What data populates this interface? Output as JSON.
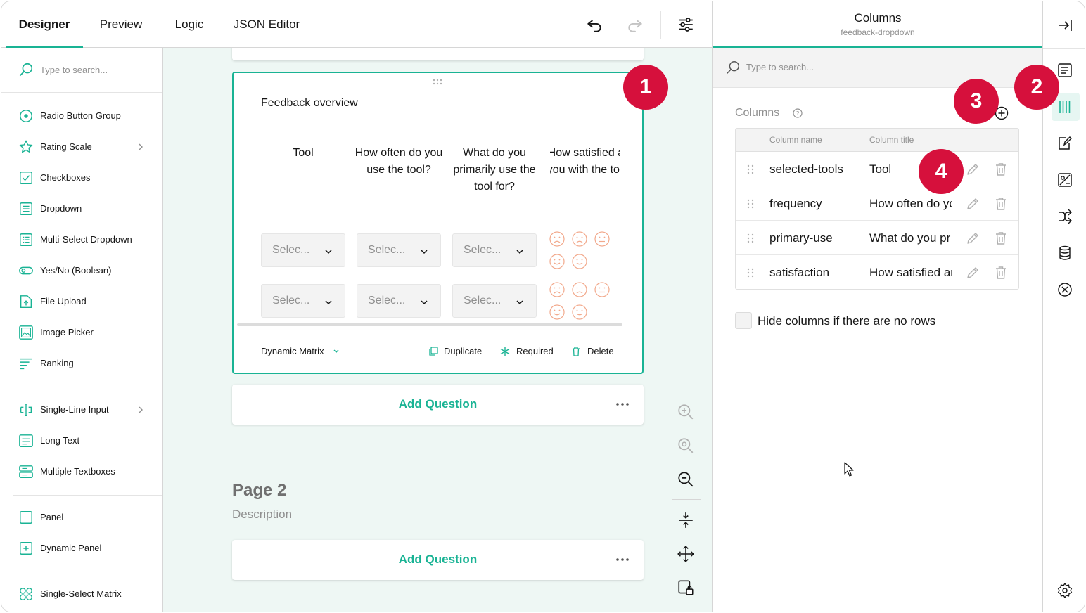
{
  "tabs": [
    "Designer",
    "Preview",
    "Logic",
    "JSON Editor"
  ],
  "toolbox": {
    "search_placeholder": "Type to search...",
    "items": [
      {
        "label": "Radio Button Group",
        "icon": "radio-icon"
      },
      {
        "label": "Rating Scale",
        "icon": "star-icon"
      },
      {
        "label": "Checkboxes",
        "icon": "checkbox-icon"
      },
      {
        "label": "Dropdown",
        "icon": "dropdown-icon"
      },
      {
        "label": "Multi-Select Dropdown",
        "icon": "multi-dropdown-icon"
      },
      {
        "label": "Yes/No (Boolean)",
        "icon": "toggle-icon"
      },
      {
        "label": "File Upload",
        "icon": "file-upload-icon"
      },
      {
        "label": "Image Picker",
        "icon": "image-picker-icon"
      },
      {
        "label": "Ranking",
        "icon": "ranking-icon"
      },
      {
        "label": "Single-Line Input",
        "icon": "text-input-icon"
      },
      {
        "label": "Long Text",
        "icon": "long-text-icon"
      },
      {
        "label": "Multiple Textboxes",
        "icon": "multiple-textboxes-icon"
      },
      {
        "label": "Panel",
        "icon": "panel-icon"
      },
      {
        "label": "Dynamic Panel",
        "icon": "dynamic-panel-icon"
      },
      {
        "label": "Single-Select Matrix",
        "icon": "matrix-icon"
      }
    ]
  },
  "question": {
    "title": "Feedback overview",
    "columns": [
      "Tool",
      "How often do you use the tool?",
      "What do you primarily use the tool for?",
      "How satisfied are you with the tool?"
    ],
    "select_placeholder": "Selec...",
    "type_label": "Dynamic Matrix",
    "duplicate_label": "Duplicate",
    "required_label": "Required",
    "delete_label": "Delete"
  },
  "add_question_label": "Add Question",
  "page2": {
    "title": "Page 2",
    "description": "Description"
  },
  "property_panel": {
    "title": "Columns",
    "subtitle": "feedback-dropdown",
    "search_placeholder": "Type to search...",
    "section_title": "Columns",
    "grid_headers": {
      "name": "Column name",
      "title": "Column title"
    },
    "rows": [
      {
        "name": "selected-tools",
        "title": "Tool"
      },
      {
        "name": "frequency",
        "title": "How often do yo"
      },
      {
        "name": "primary-use",
        "title": "What do you pr"
      },
      {
        "name": "satisfaction",
        "title": "How satisfied ar"
      }
    ],
    "hide_columns_label": "Hide columns if there are no rows"
  },
  "callouts": [
    "1",
    "2",
    "3",
    "4"
  ],
  "colors": {
    "accent": "#19b394",
    "callout": "#d6103c",
    "face": "#f2a98c"
  }
}
